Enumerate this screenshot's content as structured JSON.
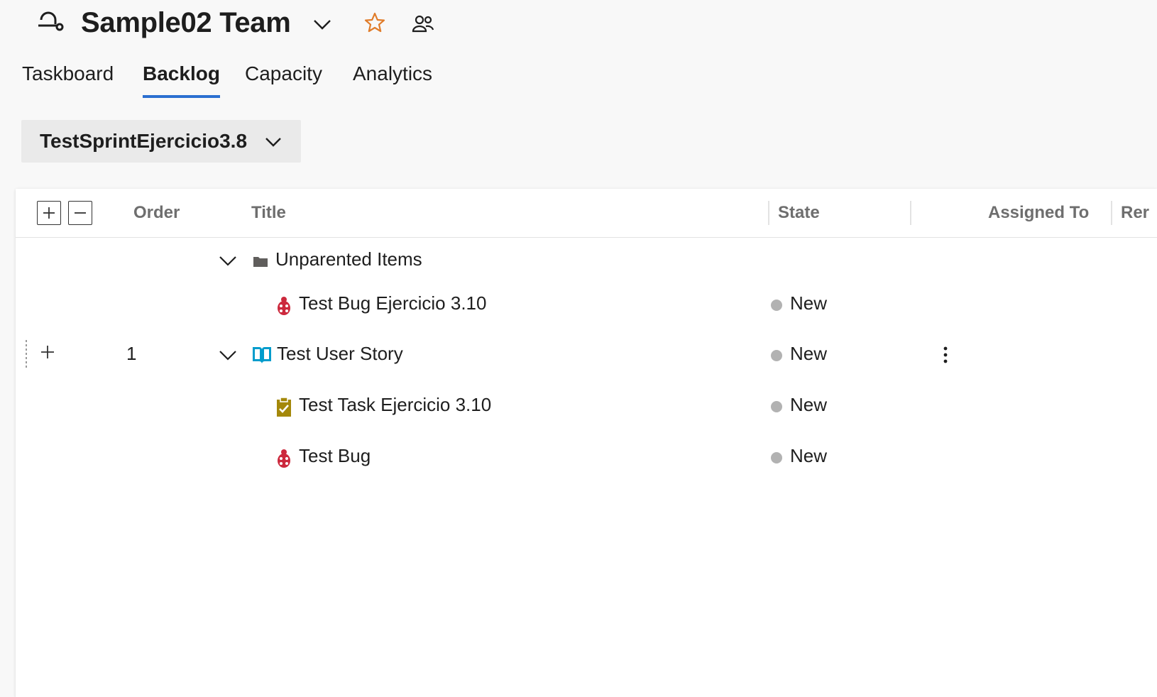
{
  "header": {
    "team_name": "Sample02 Team"
  },
  "tabs": [
    {
      "label": "Taskboard",
      "active": false
    },
    {
      "label": "Backlog",
      "active": true
    },
    {
      "label": "Capacity",
      "active": false
    },
    {
      "label": "Analytics",
      "active": false
    }
  ],
  "sprint": {
    "label": "TestSprintEjercicio3.8"
  },
  "grid": {
    "columns": {
      "order": "Order",
      "title": "Title",
      "state": "State",
      "assigned_to": "Assigned To",
      "remaining": "Rer"
    },
    "rows": [
      {
        "order": "",
        "title": "Unparented Items",
        "state": "",
        "type_icon": "folder-icon"
      },
      {
        "order": "",
        "title": "Test Bug Ejercicio 3.10",
        "state": "New",
        "type_icon": "bug-icon"
      },
      {
        "order": "1",
        "title": "Test User Story",
        "state": "New",
        "type_icon": "user-story-icon"
      },
      {
        "order": "",
        "title": "Test Task Ejercicio 3.10",
        "state": "New",
        "type_icon": "task-icon"
      },
      {
        "order": "",
        "title": "Test Bug",
        "state": "New",
        "type_icon": "bug-icon"
      }
    ]
  },
  "colors": {
    "accent": "#2b6fd0",
    "bug": "#cc293d",
    "user_story": "#009ccc",
    "task": "#a4880a",
    "state_new": "#b2b2b2",
    "favorite": "#e07c2a"
  }
}
